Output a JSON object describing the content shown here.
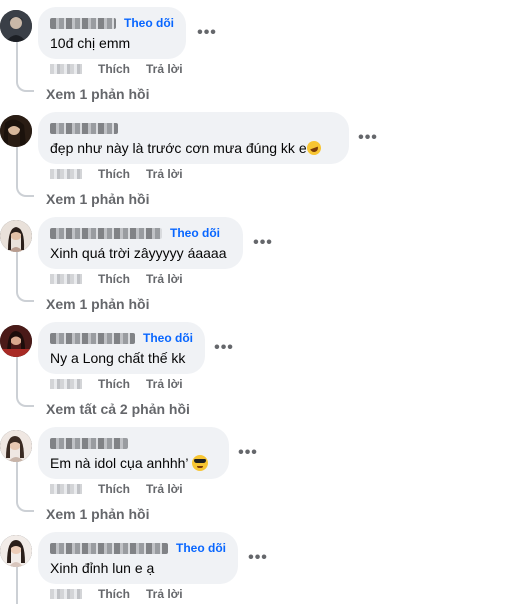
{
  "comments": [
    {
      "text": "10đ chị emm",
      "follow_label": "Theo dõi",
      "more_label": "•••",
      "like_label": "Thích",
      "reply_label": "Trả lời",
      "view_replies": "Xem 1 phản hồi",
      "emoji": ""
    },
    {
      "text": "đẹp như này là trước cơn mưa đúng kk e",
      "follow_label": "",
      "more_label": "•••",
      "like_label": "Thích",
      "reply_label": "Trả lời",
      "view_replies": "Xem 1 phản hồi",
      "emoji": "rolling-on-floor-laughing"
    },
    {
      "text": "Xinh quá trời zâyyyyy áaaaa",
      "follow_label": "Theo dõi",
      "more_label": "•••",
      "like_label": "Thích",
      "reply_label": "Trả lời",
      "view_replies": "Xem 1 phản hồi",
      "emoji": ""
    },
    {
      "text": "Ny a Long chất thế kk",
      "follow_label": "Theo dõi",
      "more_label": "•••",
      "like_label": "Thích",
      "reply_label": "Trả lời",
      "view_replies": "Xem tất cả 2 phản hồi",
      "emoji": ""
    },
    {
      "text": "Em nà idol cụa anhhh’",
      "follow_label": "",
      "more_label": "•••",
      "like_label": "Thích",
      "reply_label": "Trả lời",
      "view_replies": "Xem 1 phản hồi",
      "emoji": "smiling-face-with-sunglasses"
    },
    {
      "text": "Xinh đỉnh lun e ạ",
      "follow_label": "Theo dõi",
      "more_label": "•••",
      "like_label": "Thích",
      "reply_label": "Trả lời",
      "view_replies": "",
      "emoji": ""
    }
  ],
  "colors": {
    "bubble": "#f0f2f5",
    "follow": "#0866ff",
    "muted": "#65676b",
    "thread_line": "#ccd0d5"
  },
  "icons": {
    "more": "more-options-icon",
    "avatar": "user-avatar"
  }
}
